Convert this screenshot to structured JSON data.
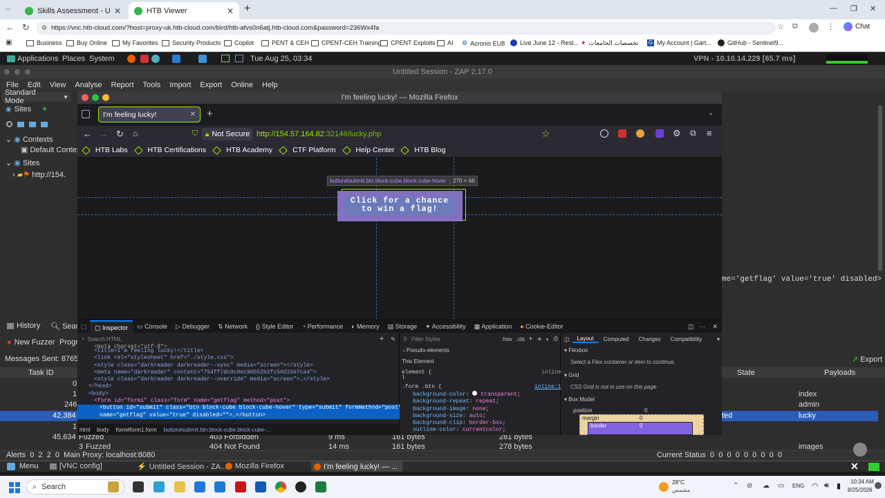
{
  "chrome": {
    "tabs": [
      {
        "label": "Skills Assessment - Using Web Pr",
        "active": false
      },
      {
        "label": "HTB Viewer",
        "active": true
      }
    ],
    "new_tab": "+",
    "url": "https://vnc.htb-cloud.com/?host=proxy-uk.htb-cloud.com/bird/htb-afvs0n6atj.htb-cloud.com&password=236Wx4fa",
    "chat_label": "Chat",
    "bookmarks": [
      "Business",
      "Buy Online",
      "My Favorites",
      "Security Products",
      "Copilot",
      "PENT & CEH",
      "CPENT-CEH Training",
      "CPENT Exploits",
      "AI",
      "Acronis EU8",
      "Live June 12 - Rest...",
      "تخصصات الجامعات",
      "My Account | Gart...",
      "GitHub - Sentinel9..."
    ]
  },
  "panel": {
    "menus": [
      "Applications",
      "Places",
      "System"
    ],
    "datetime": "Tue Aug 25, 03:34",
    "vpn": "VPN - 10.10.14.229 [65.7 ms]"
  },
  "zap": {
    "title": "Untitled Session - ZAP 2.17.0",
    "menu": [
      "File",
      "Edit",
      "View",
      "Analyse",
      "Report",
      "Tools",
      "Import",
      "Export",
      "Online",
      "Help"
    ],
    "mode": "Standard Mode",
    "sites_tab": "Sites",
    "tree": [
      "Contexts",
      "Default Contex",
      "Sites",
      "http://154."
    ],
    "right_snippet": "me='getflag' value='true' disabled>",
    "bottom_tabs": [
      "History",
      "Searc"
    ],
    "fuzzer_label": "New Fuzzer",
    "progress_label": "Progr",
    "messages_sent": "Messages Sent: 87651",
    "export_label": "Export",
    "columns": [
      "Task ID",
      "State",
      "Payloads"
    ],
    "rows": [
      {
        "id": "0",
        "state": "",
        "payload": "index"
      },
      {
        "id": "1",
        "state": "",
        "payload": "admin"
      },
      {
        "id": "246",
        "state": "",
        "payload": ""
      },
      {
        "id": "42,384",
        "state": "ted",
        "payload": "lucky"
      },
      {
        "id": "1",
        "state": "",
        "payload": ""
      },
      {
        "id": "45,634",
        "extra": [
          "Fuzzed",
          "403 Forbidden",
          "9 ms",
          "161 bytes",
          "281 bytes"
        ],
        "payload": ""
      },
      {
        "id": "3",
        "extra": [
          "Fuzzed",
          "404 Not Found",
          "14 ms",
          "161 bytes",
          "278 bytes"
        ],
        "payload": "images"
      }
    ],
    "status": "Alerts  0  2  2  0  Main Proxy: localhost:8080",
    "current_status": "Current Status  0  0  0  0  0  0  0  0  0"
  },
  "firefox": {
    "window_title": "I'm feeling lucky! — Mozilla Firefox",
    "tab_label": "I'm feeling lucky!",
    "not_secure": "Not Secure",
    "url_host": "http://154.57.164.82",
    "url_path": ":32146/lucky.php",
    "bookmarks": [
      "HTB Labs",
      "HTB Certifications",
      "HTB Academy",
      "CTF Platform",
      "Help Center",
      "HTB Blog"
    ],
    "page_button": "Click for a chance to win a flag!",
    "tooltip_selector": "button#submit.btn.block-cube.block-cube-hover",
    "tooltip_size": "270 × 66"
  },
  "devtools": {
    "tabs": [
      "Inspector",
      "Console",
      "Debugger",
      "Network",
      "Style Editor",
      "Performance",
      "Memory",
      "Storage",
      "Accessibility",
      "Application",
      "Cookie-Editor"
    ],
    "search_placeholder": "Search HTML",
    "html_lines": [
      "<meta charset=\"utf-8\">",
      "<title>I'm feeling lucky!</title>",
      "<link rel=\"stylesheet\" href=\"./style.css\">",
      "<style class=\"darkreader darkreader--sync\" media=\"screen\"></style>",
      "<meta name=\"darkreader\" content=\"754ff7dc0c0ec96b52b2fc50d1567ca4\">",
      "<style class=\"darkreader darkreader--override\" media=\"screen\">…</style>",
      "</head>",
      "<body>",
      "<form id=\"form1\" class=\"form\" name=\"getflag\" method=\"post\">",
      "<button id=\"submit\" class=\"btn block-cube block-cube-hover\" type=\"submit\" formmethod=\"post\"",
      "name=\"getflag\" value=\"true\" disabled=\"\">…</button>"
    ],
    "breadcrumbs": [
      "html",
      "body",
      "form#form1.form",
      "button#submit.btn.block-cube.block-cube-..."
    ],
    "filter_placeholder": "Filter Styles",
    "hov": ":hov",
    "cls": ".cls",
    "pseudo": "Pseudo-elements",
    "this_element": "This Element",
    "element_rule": "element {",
    "inline": "inline",
    "rule_selector": ".form .btn {",
    "rule_source": "inline:1",
    "properties": [
      {
        "name": "background-color",
        "value": "transparent"
      },
      {
        "name": "background-repeat",
        "value": "repeat"
      },
      {
        "name": "background-image",
        "value": "none"
      },
      {
        "name": "background-size",
        "value": "auto"
      },
      {
        "name": "background-clip",
        "value": "border-box"
      },
      {
        "name": "outline-color",
        "value": "currentcolor"
      }
    ],
    "layout_tabs": [
      "Layout",
      "Computed",
      "Changes",
      "Compatibility"
    ],
    "flexbox": "Flexbox",
    "flex_hint": "Select a Flex container or item to continue.",
    "grid": "Grid",
    "grid_hint": "CSS Grid is not in use on this page",
    "box_model": "Box Model",
    "position": "position",
    "position_val": "0",
    "margin": "margin",
    "margin_val": "0",
    "border": "border",
    "border_val": "0"
  },
  "vnc_taskbar": {
    "menu": "Menu",
    "items": [
      "[VNC config]",
      "Untitled Session - ZA...",
      "Mozilla Firefox",
      "I'm feeling lucky! — ..."
    ]
  },
  "windows_taskbar": {
    "search": "Search",
    "weather_temp": "28°C",
    "weather_desc": "مشمس",
    "lang": "ENG",
    "time": "10:34 AM",
    "date": "8/25/2026"
  }
}
